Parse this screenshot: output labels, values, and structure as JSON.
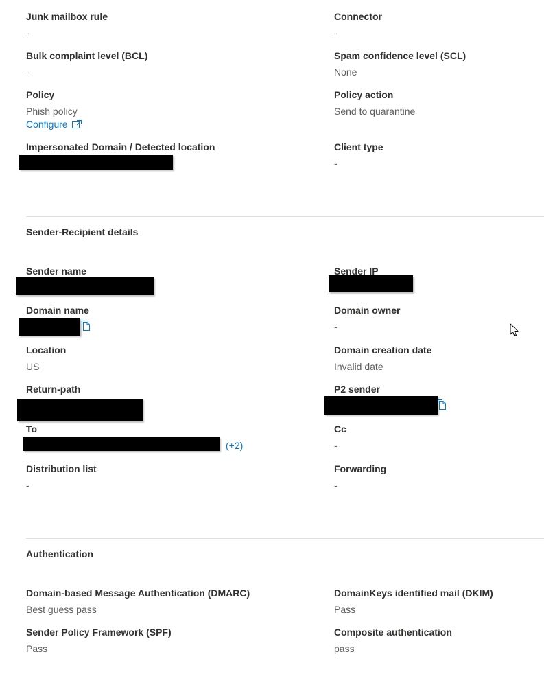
{
  "rows1": {
    "junk_label": "Junk mailbox rule",
    "junk_value": "-",
    "connector_label": "Connector",
    "connector_value": "-",
    "bcl_label": "Bulk complaint level (BCL)",
    "bcl_value": "-",
    "scl_label": "Spam confidence level (SCL)",
    "scl_value": "None",
    "policy_label": "Policy",
    "policy_value": "Phish policy",
    "configure_link": "Configure",
    "policy_action_label": "Policy action",
    "policy_action_value": "Send to quarantine",
    "impersonated_label": "Impersonated Domain / Detected location",
    "client_type_label": "Client type",
    "client_type_value": "-"
  },
  "sender_recipient": {
    "title": "Sender-Recipient details",
    "sender_name_label": "Sender name",
    "sender_ip_label": "Sender IP",
    "domain_name_label": "Domain name",
    "domain_owner_label": "Domain owner",
    "domain_owner_value": "-",
    "location_label": "Location",
    "location_value": "US",
    "domain_creation_label": "Domain creation date",
    "domain_creation_value": "Invalid date",
    "return_path_label": "Return-path",
    "p2_sender_label": "P2 sender",
    "to_label": "To",
    "to_more": "(+2)",
    "cc_label": "Cc",
    "cc_value": "-",
    "distribution_label": "Distribution list",
    "distribution_value": "-",
    "forwarding_label": "Forwarding",
    "forwarding_value": "-"
  },
  "authentication": {
    "title": "Authentication",
    "dmarc_label": "Domain-based Message Authentication (DMARC)",
    "dmarc_value": "Best guess pass",
    "dkim_label": "DomainKeys identified mail (DKIM)",
    "dkim_value": "Pass",
    "spf_label": "Sender Policy Framework (SPF)",
    "spf_value": "Pass",
    "composite_label": "Composite authentication",
    "composite_value": "pass"
  },
  "colors": {
    "link": "#0078d4",
    "label": "#323130",
    "value": "#605e5c",
    "divider": "#e1dfdd"
  },
  "icons": [
    "external-link-icon",
    "copy-icon",
    "mouse-cursor-icon"
  ]
}
